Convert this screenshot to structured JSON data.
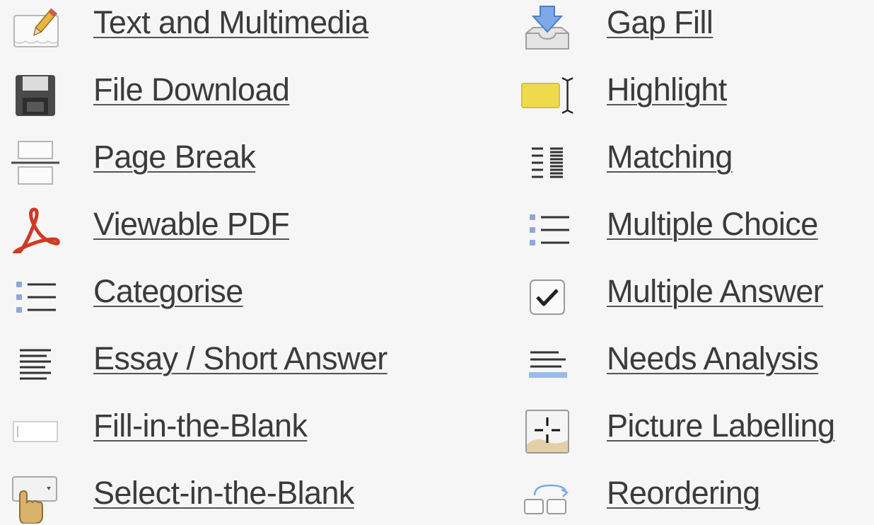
{
  "left_column": [
    {
      "label": "Text and Multimedia",
      "icon": "pencil-note-icon"
    },
    {
      "label": "File Download",
      "icon": "floppy-disk-icon"
    },
    {
      "label": "Page Break",
      "icon": "page-break-icon"
    },
    {
      "label": "Viewable PDF",
      "icon": "pdf-icon"
    },
    {
      "label": "Categorise",
      "icon": "bulleted-list-icon"
    },
    {
      "label": "Essay / Short Answer",
      "icon": "text-lines-icon"
    },
    {
      "label": "Fill-in-the-Blank",
      "icon": "text-field-icon"
    },
    {
      "label": "Select-in-the-Blank",
      "icon": "select-dropdown-icon"
    }
  ],
  "right_column": [
    {
      "label": "Gap Fill",
      "icon": "download-tray-icon"
    },
    {
      "label": "Highlight",
      "icon": "highlighter-icon"
    },
    {
      "label": "Matching",
      "icon": "matching-columns-icon"
    },
    {
      "label": "Multiple Choice",
      "icon": "bulleted-list-icon"
    },
    {
      "label": "Multiple Answer",
      "icon": "checkbox-checked-icon"
    },
    {
      "label": "Needs Analysis",
      "icon": "text-lines-bar-icon"
    },
    {
      "label": "Picture Labelling",
      "icon": "picture-crosshair-icon"
    },
    {
      "label": "Reordering",
      "icon": "reorder-boxes-icon"
    }
  ]
}
